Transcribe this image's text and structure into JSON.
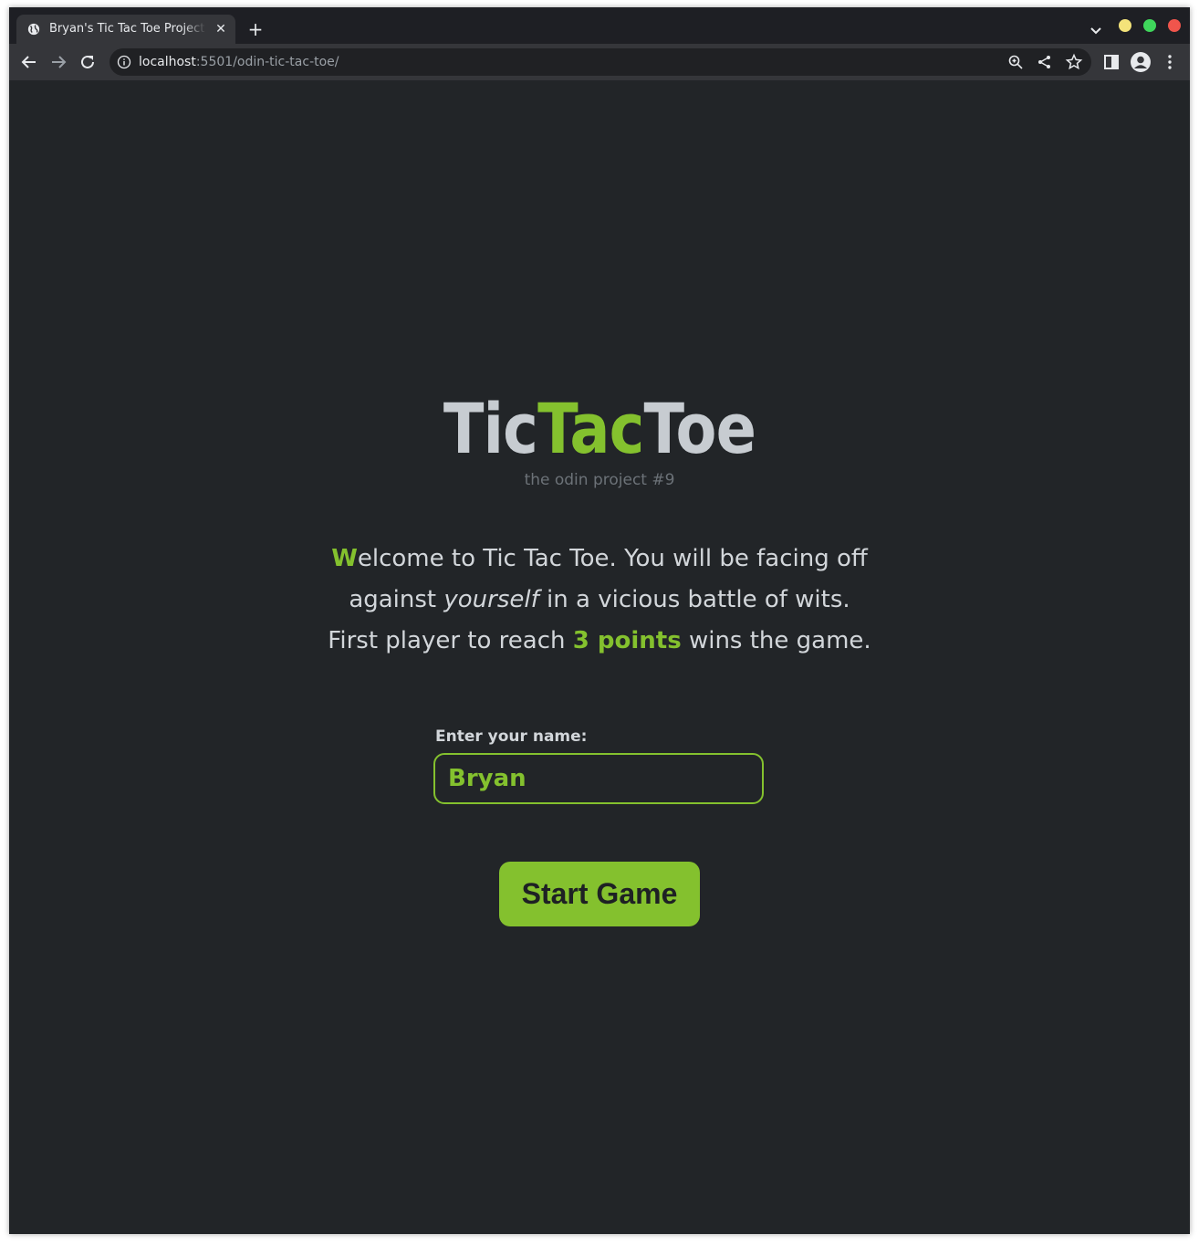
{
  "browser": {
    "tab_title": "Bryan's Tic Tac Toe Project",
    "close_glyph": "✕",
    "new_tab_glyph": "+",
    "url_host": "localhost",
    "url_path": ":5501/odin-tic-tac-toe/",
    "icons": [
      "globe-icon",
      "chevron-down-icon",
      "back-arrow-icon",
      "forward-arrow-icon",
      "reload-icon",
      "info-icon",
      "zoom-icon",
      "share-icon",
      "star-icon",
      "side-panel-icon",
      "profile-avatar-icon",
      "kebab-menu-icon"
    ],
    "traffic_lights": {
      "yellow": "#f4e37a",
      "green": "#3fd65b",
      "red": "#f0554c"
    }
  },
  "page": {
    "logo": {
      "part1": "Tic",
      "part2": "Tac",
      "part3": "Toe"
    },
    "subtitle": "the odin project #9",
    "intro": {
      "first_letter": "W",
      "text_a": "elcome to Tic Tac Toe. You will be facing off against ",
      "emphasis": "yourself",
      "text_b": " in a vicious battle of wits. First player to reach ",
      "points": "3 points",
      "text_c": " wins the game."
    },
    "name_label": "Enter your name:",
    "name_value": "Bryan",
    "start_button": "Start Game"
  },
  "colors": {
    "accent": "#84c12e",
    "background": "#222528",
    "text": "#d2d6da",
    "muted": "#6c7278"
  }
}
